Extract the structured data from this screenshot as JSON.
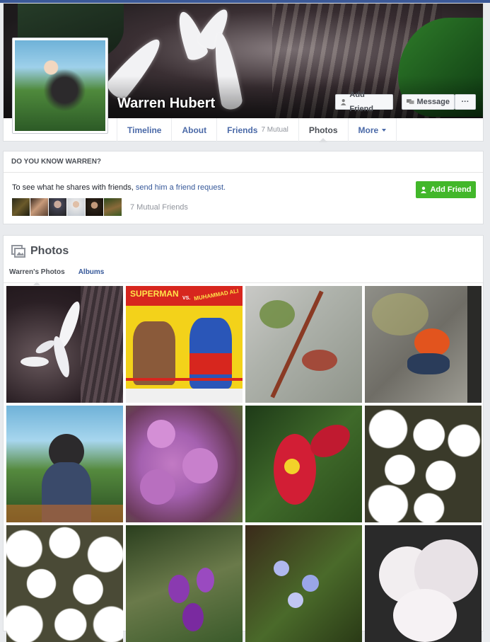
{
  "profile": {
    "name": "Warren Hubert",
    "add_friend_label": "Add Friend",
    "message_label": "Message",
    "more_label": "···"
  },
  "nav": {
    "items": [
      {
        "label": "Timeline"
      },
      {
        "label": "About"
      },
      {
        "label": "Friends",
        "count": "7 Mutual"
      },
      {
        "label": "Photos"
      },
      {
        "label": "More"
      }
    ]
  },
  "know": {
    "title": "DO YOU KNOW WARREN?",
    "text_prefix": "To see what he shares with friends,",
    "text_link": "send him a friend request.",
    "add_friend_label": "Add Friend",
    "mutual_label": "7 Mutual Friends"
  },
  "photos": {
    "title": "Photos",
    "tab_own": "Warren's Photos",
    "tab_albums": "Albums",
    "thumbnails": [
      {
        "subject": "white flower on dark leaves"
      },
      {
        "subject": "Superman vs Muhammad Ali comic cover"
      },
      {
        "subject": "red twigs with buds"
      },
      {
        "subject": "red poison dart frog on rock"
      },
      {
        "subject": "man with camera profile photo"
      },
      {
        "subject": "purple lilac flowers"
      },
      {
        "subject": "red begonia flower"
      },
      {
        "subject": "white spirea flowers"
      },
      {
        "subject": "white spirea flowers"
      },
      {
        "subject": "purple wildflowers"
      },
      {
        "subject": "small blue flowers"
      },
      {
        "subject": "white rhododendron blossoms"
      }
    ]
  },
  "comic_text": {
    "line1": "SUPERMAN",
    "line2": "VS.",
    "line3": "MUHAMMAD ALI"
  }
}
